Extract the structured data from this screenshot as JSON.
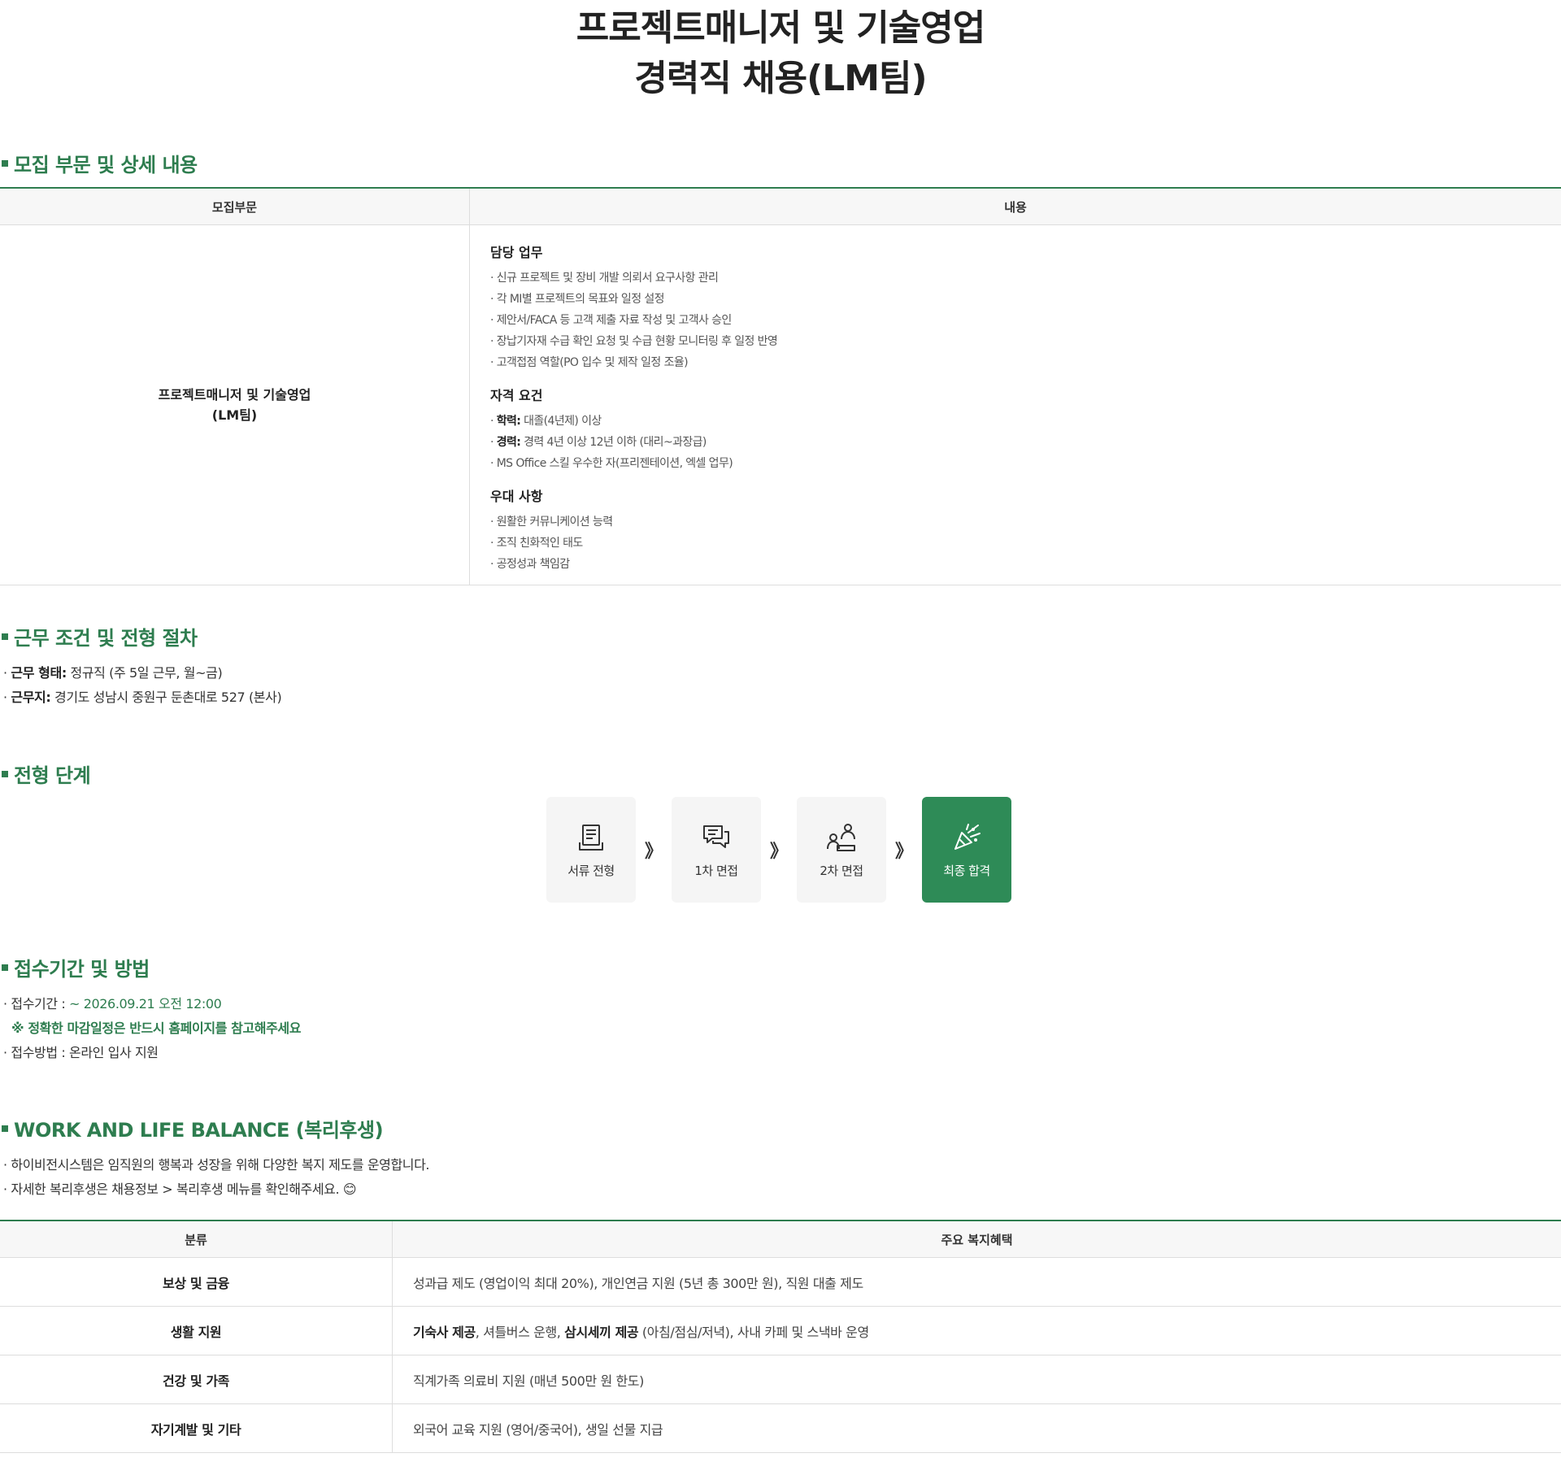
{
  "page": {
    "title_line1": "프로젝트매니저 및 기술영업",
    "title_line2": "경력직 채용(LM팀)"
  },
  "colors": {
    "accent": "#2e7d4f",
    "final_step_bg": "#2e8b57"
  },
  "recruit_section": {
    "heading": "모집 부문 및 상세 내용",
    "col_dept": "모집부문",
    "col_content": "내용",
    "dept_line1": "프로젝트매니저 및 기술영업",
    "dept_line2": "(LM팀)",
    "duties": {
      "heading": "담당 업무",
      "items": [
        "· 신규 프로젝트 및 장비 개발 의뢰서 요구사항 관리",
        "· 각 MI별 프로젝트의 목표와 일정 설정",
        "· 제안서/FACA 등 고객 제출 자료 작성 및 고객사 승인",
        "· 장납기자재 수급 확인 요청 및 수급 현황 모니터링 후 일정 반영",
        "· 고객접점 역할(PO 입수 및 제작 일정 조율)"
      ]
    },
    "requirements": {
      "heading": "자격 요건",
      "edu_label": "학력:",
      "edu_value": " 대졸(4년제) 이상",
      "career_label": "경력:",
      "career_value": " 경력 4년 이상 12년 이하 (대리~과장급)",
      "ms_office": "· MS Office 스킬 우수한 자(프리젠테이션, 엑셀 업무)"
    },
    "preferred": {
      "heading": "우대 사항",
      "items": [
        "· 원활한 커뮤니케이션 능력",
        "· 조직 친화적인 태도",
        "· 공정성과 책임감"
      ]
    }
  },
  "conditions_section": {
    "heading": "근무 조건 및 전형 절차",
    "work_type_label": "근무 형태:",
    "work_type_value": " 정규직 (주 5일 근무, 월~금)",
    "location_label": "근무지:",
    "location_value": " 경기도 성남시 중원구 둔촌대로 527 (본사)"
  },
  "steps_section": {
    "heading": "전형 단계",
    "arrow": "》",
    "steps": [
      {
        "label": "서류 전형",
        "icon": "document-icon"
      },
      {
        "label": "1차 면접",
        "icon": "chat-icon"
      },
      {
        "label": "2차 면접",
        "icon": "interview-icon"
      },
      {
        "label": "최종 합격",
        "icon": "celebration-icon"
      }
    ]
  },
  "application_section": {
    "heading": "접수기간 및 방법",
    "period_label": "· 접수기간 : ",
    "period_value": "~ 2026.09.21 오전 12:00",
    "notice": "※ 정확한 마감일정은 반드시 홈페이지를 참고해주세요",
    "method": "· 접수방법 : 온라인 입사 지원"
  },
  "welfare_section": {
    "heading": "WORK AND LIFE BALANCE (복리후생)",
    "intro1": "· 하이비전시스템은 임직원의 행복과 성장을 위해 다양한 복지 제도를 운영합니다.",
    "intro2": "· 자세한 복리후생은 채용정보 > 복리후생 메뉴를 확인해주세요. 😊",
    "col_category": "분류",
    "col_benefits": "주요 복지혜택",
    "rows": [
      {
        "category": "보상 및 금융",
        "benefits": "성과급 제도 (영업이익 최대 20%), 개인연금 지원 (5년 총 300만 원), 직원 대출 제도"
      },
      {
        "category": "생활 지원",
        "b1": "기숙사 제공",
        "t1": ", 셔틀버스 운행, ",
        "b2": "삼시세끼 제공",
        "t2": " (아침/점심/저녁), 사내 카페 및 스낵바 운영"
      },
      {
        "category": "건강 및 가족",
        "benefits": "직계가족 의료비 지원 (매년 500만 원 한도)"
      },
      {
        "category": "자기계발 및 기타",
        "benefits": "외국어 교육 지원 (영어/중국어), 생일 선물 지급"
      }
    ]
  }
}
